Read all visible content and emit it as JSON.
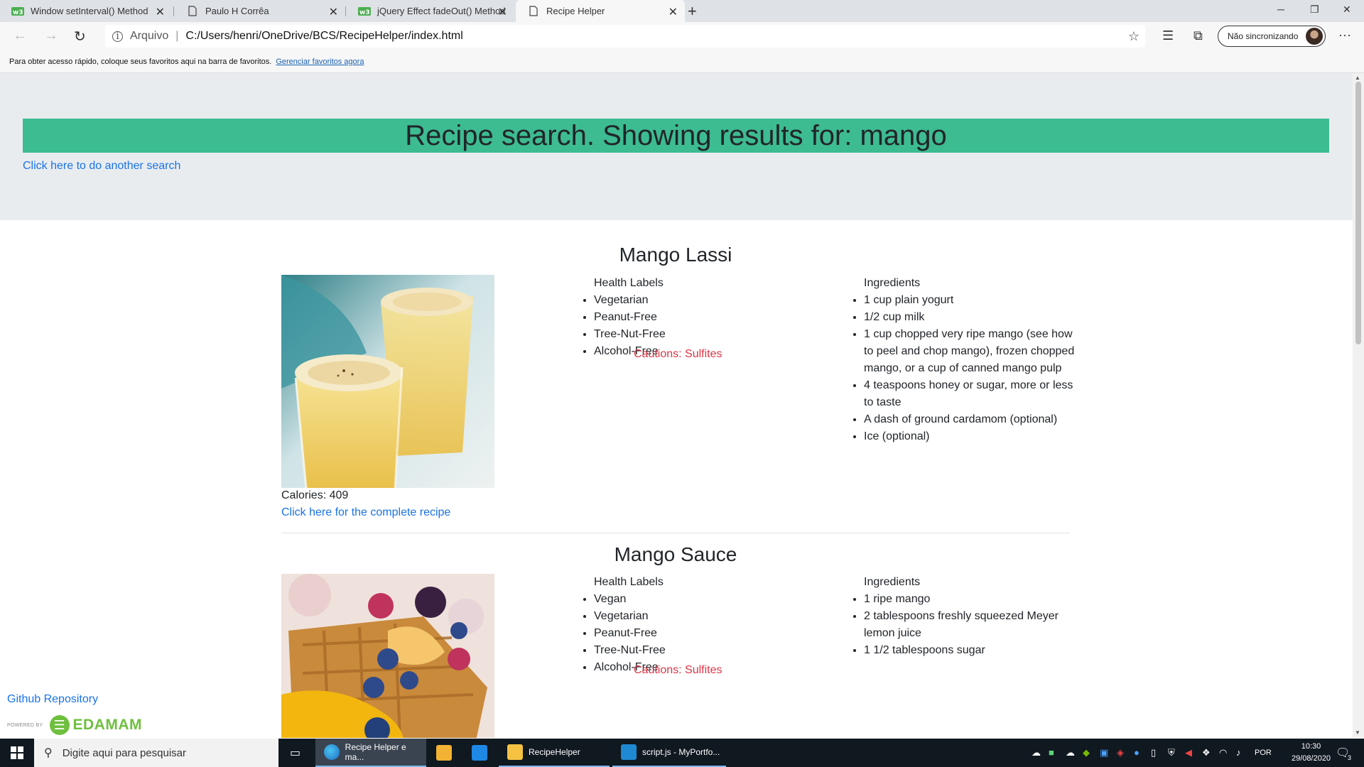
{
  "browser": {
    "tabs": [
      {
        "label": "Window setInterval() Method",
        "icon": "w3schools-icon",
        "active": false
      },
      {
        "label": "Paulo H Corrêa",
        "icon": "page-icon",
        "active": false
      },
      {
        "label": "jQuery Effect fadeOut() Method",
        "icon": "w3schools-icon",
        "active": false
      },
      {
        "label": "Recipe Helper",
        "icon": "page-icon",
        "active": true
      }
    ],
    "address": {
      "scheme_label": "Arquivo",
      "url": "C:/Users/henri/OneDrive/BCS/RecipeHelper/index.html"
    },
    "sync_label": "Não sincronizando",
    "favorites_bar": {
      "message": "Para obter acesso rápido, coloque seus favoritos aqui na barra de favoritos.",
      "link": "Gerenciar favoritos agora"
    }
  },
  "page": {
    "headline": "Recipe search. Showing results for: mango",
    "another_search_link": "Click here to do another search",
    "recipes": [
      {
        "title": "Mango Lassi",
        "image": "mango-lassi-photo",
        "health_labels_heading": "Health Labels",
        "health_labels": [
          "Vegetarian",
          "Peanut-Free",
          "Tree-Nut-Free",
          "Alcohol-Free"
        ],
        "caution": "Cautions: Sulfites",
        "ingredients_heading": "Ingredients",
        "ingredients": [
          "1 cup plain yogurt",
          "1/2 cup milk",
          "1 cup chopped very ripe mango (see how to peel and chop mango), frozen chopped mango, or a cup of canned mango pulp",
          "4 teaspoons honey or sugar, more or less to taste",
          "A dash of ground cardamom (optional)",
          "Ice (optional)"
        ],
        "calories": "Calories: 409",
        "recipe_link": "Click here for the complete recipe"
      },
      {
        "title": "Mango Sauce",
        "image": "mango-sauce-waffle-photo",
        "health_labels_heading": "Health Labels",
        "health_labels": [
          "Vegan",
          "Vegetarian",
          "Peanut-Free",
          "Tree-Nut-Free",
          "Alcohol-Free"
        ],
        "caution": "Cautions: Sulfites",
        "ingredients_heading": "Ingredients",
        "ingredients": [
          "1 ripe mango",
          "2 tablespoons freshly squeezed Meyer lemon juice",
          "1 1/2 tablespoons sugar"
        ]
      }
    ],
    "footer": {
      "github_link": "Github Repository",
      "powered_by": "POWERED BY",
      "brand": "EDAMAM"
    }
  },
  "taskbar": {
    "search_placeholder": "Digite aqui para pesquisar",
    "items": [
      {
        "label": "Recipe Helper e ma...",
        "icon": "edge-icon",
        "active": true
      },
      {
        "label": "",
        "icon": "store-icon",
        "active": false
      },
      {
        "label": "",
        "icon": "mail-icon",
        "active": false
      },
      {
        "label": "RecipeHelper",
        "icon": "folder-icon",
        "active": false
      },
      {
        "label": "script.js - MyPortfo...",
        "icon": "vscode-icon",
        "active": false
      }
    ],
    "language": "POR",
    "time": "10:30",
    "date": "29/08/2020",
    "notifications": "3"
  }
}
